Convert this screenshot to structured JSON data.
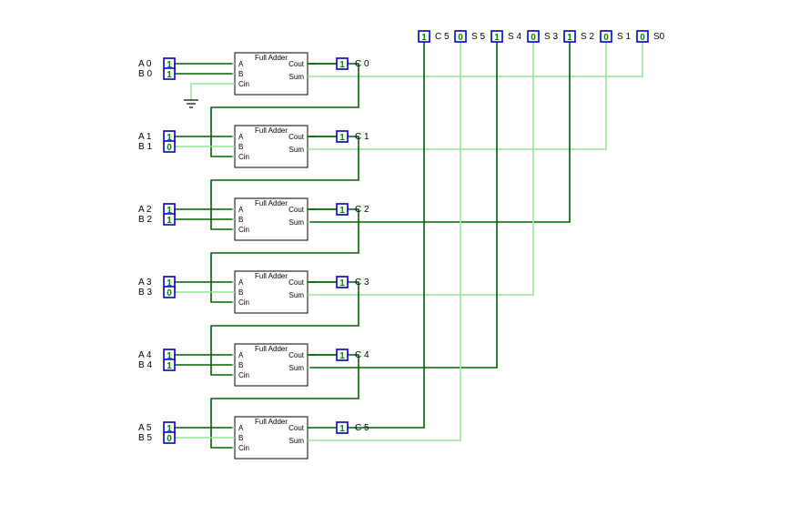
{
  "chart_data": {
    "type": "diagram",
    "description": "6-bit ripple-carry adder built from Full Adder blocks",
    "block_label": "Full Adder",
    "pin_labels": {
      "A": "A",
      "B": "B",
      "Cin": "Cin",
      "Cout": "Cout",
      "Sum": "Sum"
    },
    "adders": [
      {
        "idx": 0,
        "A": "1",
        "B": "1",
        "Cin": "0",
        "Cout": "1",
        "Sum": "0",
        "A_lbl": "A 0",
        "B_lbl": "B 0",
        "C_lbl": "C 0"
      },
      {
        "idx": 1,
        "A": "1",
        "B": "0",
        "Cin": "1",
        "Cout": "1",
        "Sum": "0",
        "A_lbl": "A 1",
        "B_lbl": "B 1",
        "C_lbl": "C 1"
      },
      {
        "idx": 2,
        "A": "1",
        "B": "1",
        "Cin": "1",
        "Cout": "1",
        "Sum": "1",
        "A_lbl": "A 2",
        "B_lbl": "B 2",
        "C_lbl": "C 2"
      },
      {
        "idx": 3,
        "A": "1",
        "B": "0",
        "Cin": "1",
        "Cout": "1",
        "Sum": "0",
        "A_lbl": "A 3",
        "B_lbl": "B 3",
        "C_lbl": "C 3"
      },
      {
        "idx": 4,
        "A": "1",
        "B": "1",
        "Cin": "1",
        "Cout": "1",
        "Sum": "1",
        "A_lbl": "A 4",
        "B_lbl": "B 4",
        "C_lbl": "C 4"
      },
      {
        "idx": 5,
        "A": "1",
        "B": "0",
        "Cin": "1",
        "Cout": "1",
        "Sum": "0",
        "A_lbl": "A 5",
        "B_lbl": "B 5",
        "C_lbl": "C 5"
      }
    ],
    "outputs": [
      {
        "name": "S0",
        "val": "0"
      },
      {
        "name": "S 1",
        "val": "0"
      },
      {
        "name": "S 2",
        "val": "1"
      },
      {
        "name": "S 3",
        "val": "0"
      },
      {
        "name": "S 4",
        "val": "1"
      },
      {
        "name": "S 5",
        "val": "0"
      },
      {
        "name": "C 5",
        "val": "1"
      }
    ]
  }
}
